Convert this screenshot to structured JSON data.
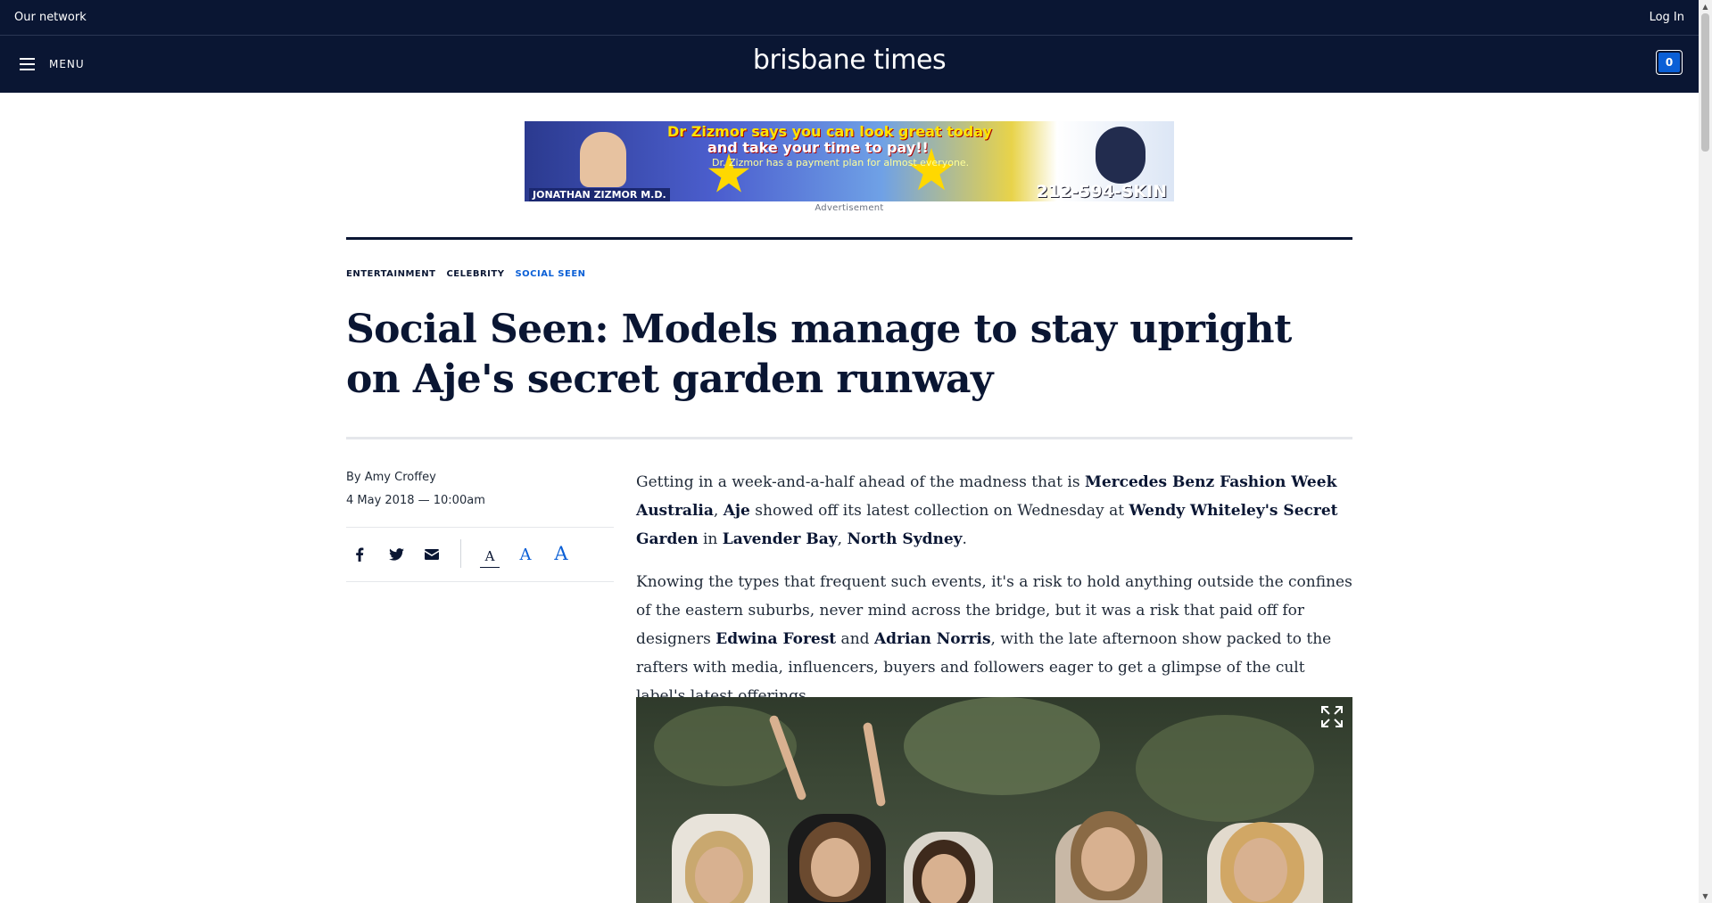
{
  "topbar": {
    "network": "Our network",
    "login": "Log In"
  },
  "header": {
    "menu_label": "MENU",
    "logo": "brisbane times",
    "cart_count": "0"
  },
  "ad": {
    "line1": "Dr Zizmor says you can look great today",
    "line2": "and take your time to pay!!",
    "line3": "Dr. Zizmor has a payment plan for almost everyone.",
    "doctor": "JONATHAN ZIZMOR M.D.",
    "phone": "212-594-SKIN",
    "label": "Advertisement"
  },
  "breadcrumb": [
    "ENTERTAINMENT",
    "CELEBRITY",
    "SOCIAL SEEN"
  ],
  "article": {
    "headline": "Social Seen: Models manage to stay upright on Aje's secret garden runway",
    "byline": "By Amy Croffey",
    "date": "4 May 2018 — 10:00am",
    "font_sizes": [
      "A",
      "A",
      "A"
    ]
  },
  "colors": {
    "navy": "#0a1633",
    "accent_blue": "#0a5fd6"
  }
}
